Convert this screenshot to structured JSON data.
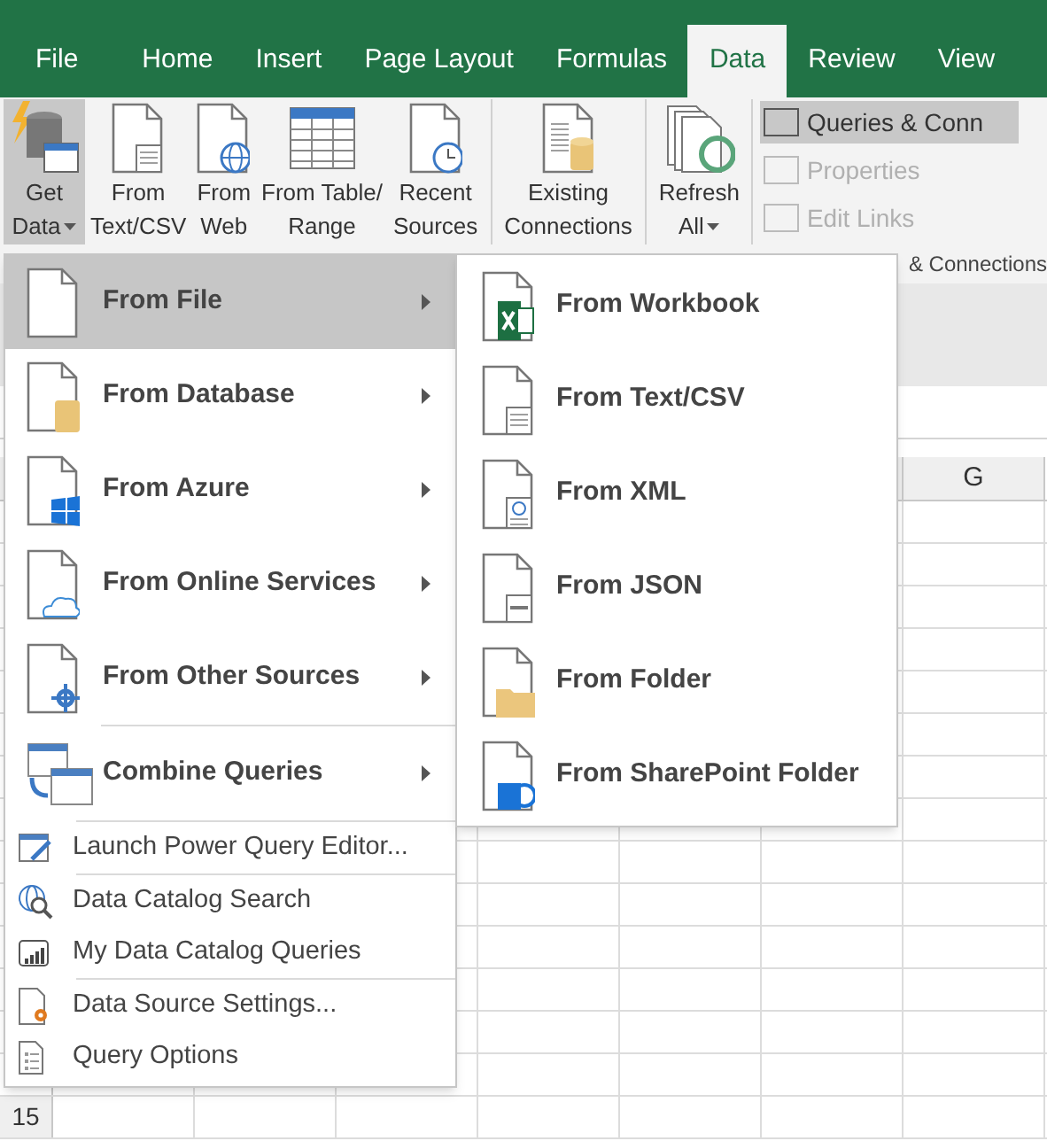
{
  "tabs": [
    {
      "label": "File",
      "selected": false
    },
    {
      "label": "Home",
      "selected": false
    },
    {
      "label": "Insert",
      "selected": false
    },
    {
      "label": "Page Layout",
      "selected": false
    },
    {
      "label": "Formulas",
      "selected": false
    },
    {
      "label": "Data",
      "selected": true
    },
    {
      "label": "Review",
      "selected": false
    },
    {
      "label": "View",
      "selected": false
    }
  ],
  "ribbon": {
    "groups": [
      [
        {
          "lines": [
            "Get",
            "Data"
          ],
          "dropdown": true,
          "selected": true
        },
        {
          "lines": [
            "From",
            "Text/CSV"
          ],
          "dropdown": false,
          "selected": false
        },
        {
          "lines": [
            "From",
            "Web"
          ],
          "dropdown": false,
          "selected": false
        },
        {
          "lines": [
            "From Table/",
            "Range"
          ],
          "dropdown": false,
          "selected": false
        },
        {
          "lines": [
            "Recent",
            "Sources"
          ],
          "dropdown": false,
          "selected": false
        }
      ],
      [
        {
          "lines": [
            "Existing",
            "Connections"
          ],
          "dropdown": false,
          "selected": false
        }
      ],
      [
        {
          "lines": [
            "Refresh",
            "All"
          ],
          "dropdown": true,
          "selected": false
        }
      ]
    ],
    "small_buttons": [
      {
        "label": "Queries & Conn",
        "selected": true,
        "disabled": false
      },
      {
        "label": "Properties",
        "selected": false,
        "disabled": true
      },
      {
        "label": "Edit Links",
        "selected": false,
        "disabled": true
      }
    ],
    "group_label": "& Connections"
  },
  "sheet": {
    "column_header": "G",
    "row_header": "15"
  },
  "menu": {
    "groups": [
      [
        {
          "label": "From File",
          "kind": "large",
          "submenu": true,
          "selected": true
        },
        {
          "label": "From Database",
          "kind": "large",
          "submenu": true,
          "selected": false
        },
        {
          "label": "From Azure",
          "kind": "large",
          "submenu": true,
          "selected": false
        },
        {
          "label": "From Online Services",
          "kind": "large",
          "submenu": true,
          "selected": false
        },
        {
          "label": "From Other Sources",
          "kind": "large",
          "submenu": true,
          "selected": false
        }
      ],
      [
        {
          "label": "Combine Queries",
          "kind": "large",
          "submenu": true,
          "selected": false
        }
      ],
      [
        {
          "label": "Launch Power Query Editor...",
          "kind": "small",
          "submenu": false,
          "selected": false
        }
      ],
      [
        {
          "label": "Data Catalog Search",
          "kind": "small",
          "submenu": false,
          "selected": false
        },
        {
          "label": "My Data Catalog Queries",
          "kind": "small",
          "submenu": false,
          "selected": false
        }
      ],
      [
        {
          "label": "Data Source Settings...",
          "kind": "small",
          "submenu": false,
          "selected": false
        },
        {
          "label": "Query Options",
          "kind": "small",
          "submenu": false,
          "selected": false
        }
      ]
    ]
  },
  "submenu": {
    "items": [
      {
        "label": "From Workbook"
      },
      {
        "label": "From Text/CSV"
      },
      {
        "label": "From XML"
      },
      {
        "label": "From JSON"
      },
      {
        "label": "From Folder"
      },
      {
        "label": "From SharePoint Folder"
      }
    ]
  }
}
